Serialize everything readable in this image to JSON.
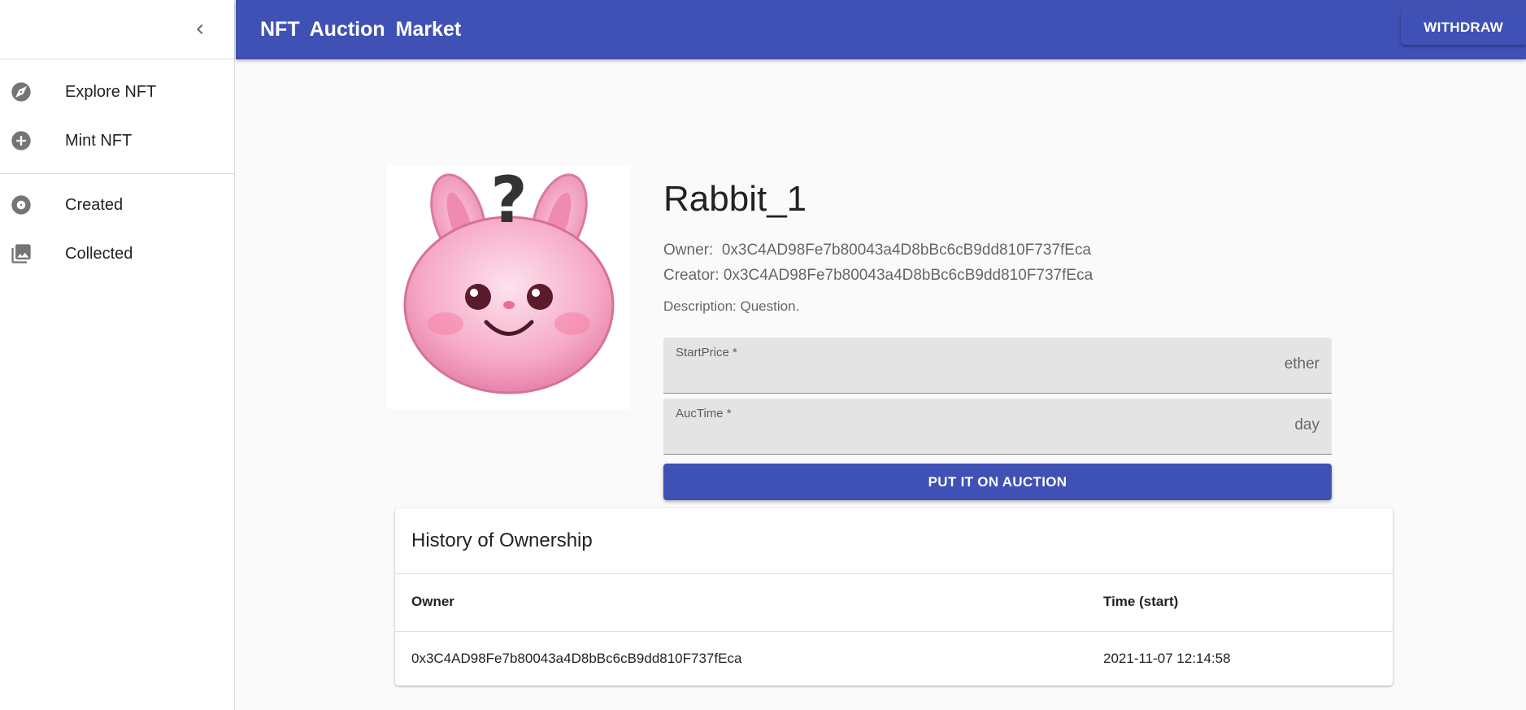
{
  "app": {
    "title": "NFT  Auction  Market",
    "withdraw_label": "WITHDRAW"
  },
  "sidebar": {
    "collapse_icon": "chevron-left-icon",
    "primary_items": [
      {
        "label": "Explore NFT",
        "icon": "compass-icon"
      },
      {
        "label": "Mint NFT",
        "icon": "add-circle-icon"
      }
    ],
    "secondary_items": [
      {
        "label": "Created",
        "icon": "disc-icon"
      },
      {
        "label": "Collected",
        "icon": "image-library-icon"
      }
    ]
  },
  "nft": {
    "image_icon": "rabbit-question-image",
    "name": "Rabbit_1",
    "owner_label": "Owner:",
    "owner": "0x3C4AD98Fe7b80043a4D8bBc6cB9dd810F737fEca",
    "creator_label": "Creator:",
    "creator": "0x3C4AD98Fe7b80043a4D8bBc6cB9dd810F737fEca",
    "description_label": "Description:",
    "description": "Question."
  },
  "auction_form": {
    "start_price": {
      "label": "StartPrice *",
      "value": "",
      "unit": "ether"
    },
    "auc_time": {
      "label": "AucTime *",
      "value": "",
      "unit": "day"
    },
    "submit_label": "PUT IT ON AUCTION"
  },
  "history": {
    "title": "History of Ownership",
    "columns": [
      "Owner",
      "Time (start)"
    ],
    "rows": [
      {
        "owner": "0x3C4AD98Fe7b80043a4D8bBc6cB9dd810F737fEca",
        "time": "2021-11-07 12:14:58"
      }
    ]
  },
  "colors": {
    "primary": "#3f51b5",
    "background": "#fafafa",
    "field_bg": "#e4e4e4"
  }
}
